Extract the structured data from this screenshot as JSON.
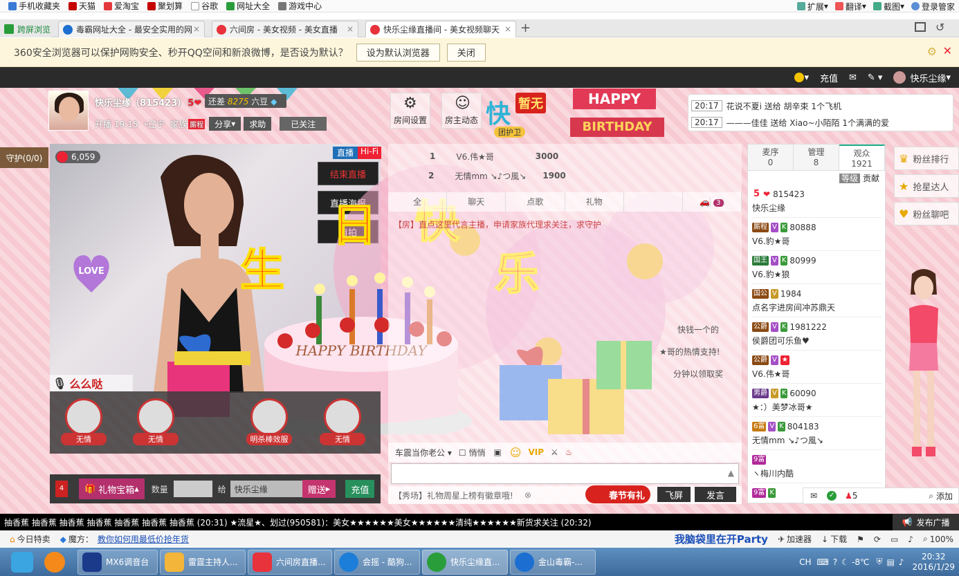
{
  "bookmarks": {
    "items": [
      "手机收藏夹",
      "天猫",
      "爱淘宝",
      "聚划算",
      "谷歌",
      "网址大全",
      "游戏中心"
    ],
    "right": [
      "扩展",
      "翻译",
      "截图",
      "登录管家"
    ]
  },
  "tabs": [
    {
      "label": "跨屏浏览"
    },
    {
      "label": "毒霸网址大全 - 最安全实用的网"
    },
    {
      "label": "六间房 - 美女视频 - 美女直播"
    },
    {
      "label": "快乐尘缘直播间 - 美女视频聊天"
    }
  ],
  "notice": {
    "message": "360安全浏览器可以保护网购安全、秒开QQ空间和新浪微博，是否设为默认？",
    "set_default": "设为默认浏览器",
    "close": "关闭"
  },
  "site_bar": {
    "recharge": "充值",
    "user": "快乐尘缘"
  },
  "host": {
    "name": "快乐尘缘（815423）",
    "level": "5",
    "diff_label": "还差",
    "diff_value": "8275",
    "diff_unit": "六豆",
    "start": "开播 19:15",
    "location": "辽宁",
    "family": "家族",
    "family_tag": "厮程",
    "share": "分享",
    "ask": "求助",
    "followed": "已关注"
  },
  "tools": {
    "settings": "房间设置",
    "dynamic": "房主动态",
    "none": "暂无",
    "guard_group": "团护卫"
  },
  "birthday": {
    "line1": "HAPPY",
    "line2": "BIRTHDAY"
  },
  "messages": [
    {
      "time": "20:17",
      "text": "花说不夏i 送给 胡辛束 1个飞机"
    },
    {
      "time": "20:17",
      "text": "———佳佳 送给 Xiao~小陌陌 1个满满的爱"
    }
  ],
  "guard": "守护(0/0)",
  "video": {
    "count": "6,059",
    "live": "直播",
    "hifi": "Hi-Fi",
    "end_live": "结束直播",
    "live_stream": "直播海报",
    "third": "自拍",
    "mic_user": "么么哒",
    "overlay": [
      "生",
      "日",
      "快",
      "乐"
    ],
    "cake": "HAPPY BIRTHDAY",
    "love": "LOVE"
  },
  "slots": [
    {
      "label": "无情"
    },
    {
      "label": "无情"
    },
    {
      "label": "明杀棒效服"
    },
    {
      "label": "无情"
    }
  ],
  "gift_bar": {
    "badge": "4",
    "gift_box": "礼物宝箱",
    "qty_label": "数量",
    "to_label": "给",
    "target": "快乐尘缘",
    "send": "赠送",
    "recharge": "充值"
  },
  "ranking": [
    {
      "rank": "1",
      "name": "V6.伟★哥",
      "value": "3000"
    },
    {
      "rank": "2",
      "name": "无情mm ↘♪つ風↘",
      "value": "1900"
    }
  ],
  "chat_tabs": [
    "全",
    "聊天",
    "点歌",
    "礼物",
    "",
    "3"
  ],
  "chat_lines": [
    "【房】直点这里代言主播，申请家族代理求关注，求守护",
    "快钱一个的",
    "★哥的热情支持!",
    "分钟以领取奖"
  ],
  "chat_tool": {
    "target": "车震当你老公",
    "whisper": "悄悄"
  },
  "chat_footer": {
    "tip": "【秀场】礼物周星上榜有徽章哦!",
    "spring": "春节有礼",
    "fly": "飞屏",
    "send": "发言"
  },
  "users": {
    "tabs": [
      {
        "label": "麦序",
        "count": "0"
      },
      {
        "label": "管理",
        "count": "8"
      },
      {
        "label": "观众",
        "count": "1921"
      }
    ],
    "sort": [
      "等级",
      "贡献"
    ],
    "rows": [
      {
        "id": "815423",
        "name": "快乐尘缘",
        "badge": "5"
      },
      {
        "id": "80888",
        "name": "V6.豹★哥",
        "badge": "厮程"
      },
      {
        "id": "80999",
        "name": "V6.豹★狼",
        "badge": "国王"
      },
      {
        "id": "1984",
        "name": "点名字进房间冲苏鼎天",
        "badge": "国公"
      },
      {
        "id": "1981222",
        "name": "侯爵团可乐鱼♥",
        "badge": "公爵"
      },
      {
        "id": "",
        "name": "V6.伟★哥",
        "badge": "公爵"
      },
      {
        "id": "60090",
        "name": "★：）美梦冰哥★",
        "badge": "男爵"
      },
      {
        "id": "804183",
        "name": "无情mm ↘♪つ風↘",
        "badge": "6富"
      },
      {
        "id": "",
        "name": "ヽ梅川内酷",
        "badge": "9富"
      },
      {
        "id": "",
        "name": "",
        "badge": "9富"
      }
    ],
    "footer_count": "5",
    "footer_add": "添加"
  },
  "fans": [
    "粉丝排行",
    "抢星达人",
    "粉丝聊吧"
  ],
  "broadcast": "发布广播",
  "marquee": "抽香蕉 抽香蕉 抽香蕉 抽香蕉 抽香蕉 抽香蕉 抽香蕉 (20:31)    ★流星★、划过(950581)：美女★★★★★★美女★★★★★★清纯★★★★★★新货求关注 (20:32)",
  "status": {
    "today": "今日特卖",
    "magic": "魔方：",
    "tip": "教你如何用最低价抢年货",
    "slogan": "我脑袋里在开Party",
    "accel": "加速器",
    "download": "下载",
    "zoom": "100%"
  },
  "taskbar": {
    "items": [
      "MX6调音台",
      "雷霆主持人...",
      "六间房直播...",
      "会摇 - 酷狗...",
      "快乐尘缘直...",
      "金山毒霸-..."
    ],
    "lang": "CH",
    "temp": "-8℃",
    "time": "20:32",
    "date": "2016/1/29"
  },
  "colors": {
    "accent": "#e8323c",
    "live_green": "#27905d",
    "gift_pink": "#b3306d",
    "pink_bg": "#f8d3d9"
  }
}
